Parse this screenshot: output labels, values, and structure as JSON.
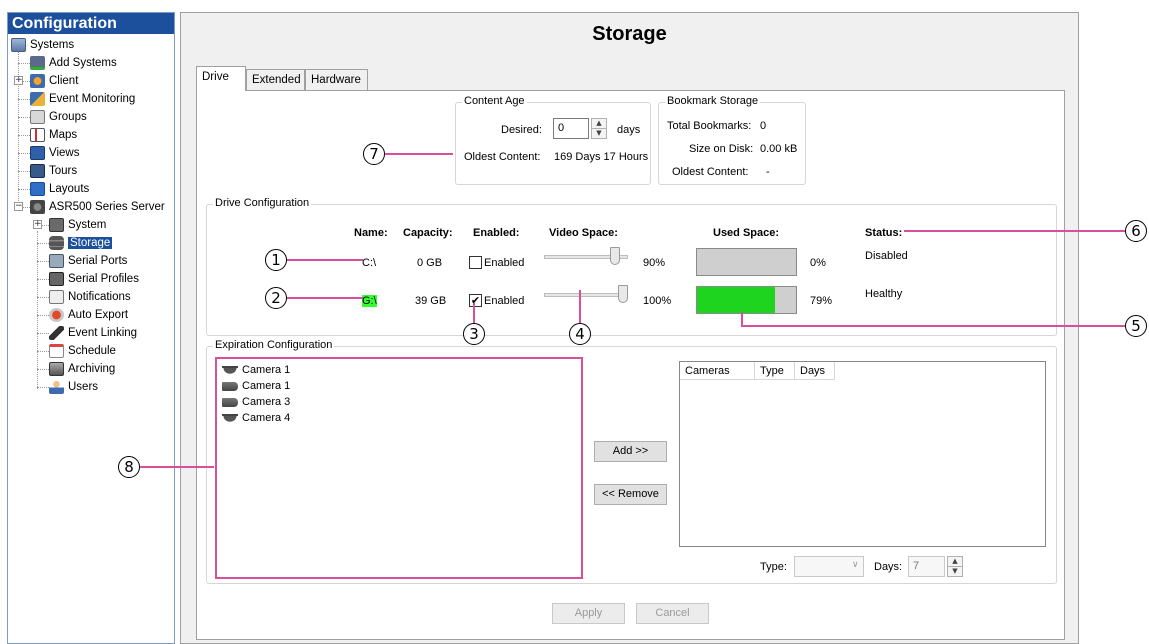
{
  "sidebar": {
    "title": "Configuration",
    "items": [
      {
        "label": "Systems"
      },
      {
        "label": "Add Systems"
      },
      {
        "label": "Client"
      },
      {
        "label": "Event Monitoring"
      },
      {
        "label": "Groups"
      },
      {
        "label": "Maps"
      },
      {
        "label": "Views"
      },
      {
        "label": "Tours"
      },
      {
        "label": "Layouts"
      },
      {
        "label": "ASR500 Series Server"
      },
      {
        "label": "System"
      },
      {
        "label": "Storage"
      },
      {
        "label": "Serial Ports"
      },
      {
        "label": "Serial Profiles"
      },
      {
        "label": "Notifications"
      },
      {
        "label": "Auto Export"
      },
      {
        "label": "Event Linking"
      },
      {
        "label": "Schedule"
      },
      {
        "label": "Archiving"
      },
      {
        "label": "Users"
      }
    ],
    "selected": "Storage"
  },
  "main": {
    "title": "Storage",
    "tabs": [
      {
        "label": "Drive"
      },
      {
        "label": "Extended"
      },
      {
        "label": "Hardware"
      }
    ],
    "active_tab": "Drive"
  },
  "content_age": {
    "title": "Content Age",
    "desired_label": "Desired:",
    "desired_value": "0",
    "days_label": "days",
    "oldest_label": "Oldest Content:",
    "oldest_value": "169 Days 17 Hours"
  },
  "bookmark_storage": {
    "title": "Bookmark Storage",
    "total_label": "Total Bookmarks:",
    "total_value": "0",
    "size_label": "Size on Disk:",
    "size_value": "0.00 kB",
    "oldest_label": "Oldest Content:",
    "oldest_value": "-"
  },
  "drive_config": {
    "title": "Drive Configuration",
    "headers": {
      "name": "Name:",
      "capacity": "Capacity:",
      "enabled": "Enabled:",
      "video_space": "Video Space:",
      "used_space": "Used Space:",
      "status": "Status:"
    },
    "drives": [
      {
        "name": "C:\\",
        "capacity": "0 GB",
        "enabled_label": "Enabled",
        "enabled": false,
        "video_space": "90%",
        "video_space_fraction": 0.9,
        "used_space": "0%",
        "used_fraction": 0.0,
        "status": "Disabled"
      },
      {
        "name": "G:\\",
        "capacity": "39 GB",
        "enabled_label": "Enabled",
        "enabled": true,
        "video_space": "100%",
        "video_space_fraction": 1.0,
        "used_space": "79%",
        "used_fraction": 0.79,
        "status": "Healthy"
      }
    ]
  },
  "expiration": {
    "title": "Expiration Configuration",
    "cameras": [
      {
        "label": "Camera 1",
        "icon": "dome-camera-icon"
      },
      {
        "label": "Camera 1",
        "icon": "bullet-camera-icon"
      },
      {
        "label": "Camera 3",
        "icon": "bullet-camera-icon"
      },
      {
        "label": "Camera 4",
        "icon": "dome-camera-icon"
      }
    ],
    "add_label": "Add >>",
    "remove_label": "<< Remove",
    "columns": [
      "Cameras",
      "Type",
      "Days"
    ],
    "type_label": "Type:",
    "type_value": "",
    "days_label": "Days:",
    "days_value": "7"
  },
  "footer": {
    "apply_label": "Apply",
    "cancel_label": "Cancel"
  },
  "callouts": [
    "1",
    "2",
    "3",
    "4",
    "5",
    "6",
    "7",
    "8"
  ],
  "colors": {
    "accent": "#1c4f9c",
    "callout_line": "#d84f9c",
    "used_fill": "#1ed41e",
    "name_highlight": "#33ff33"
  }
}
